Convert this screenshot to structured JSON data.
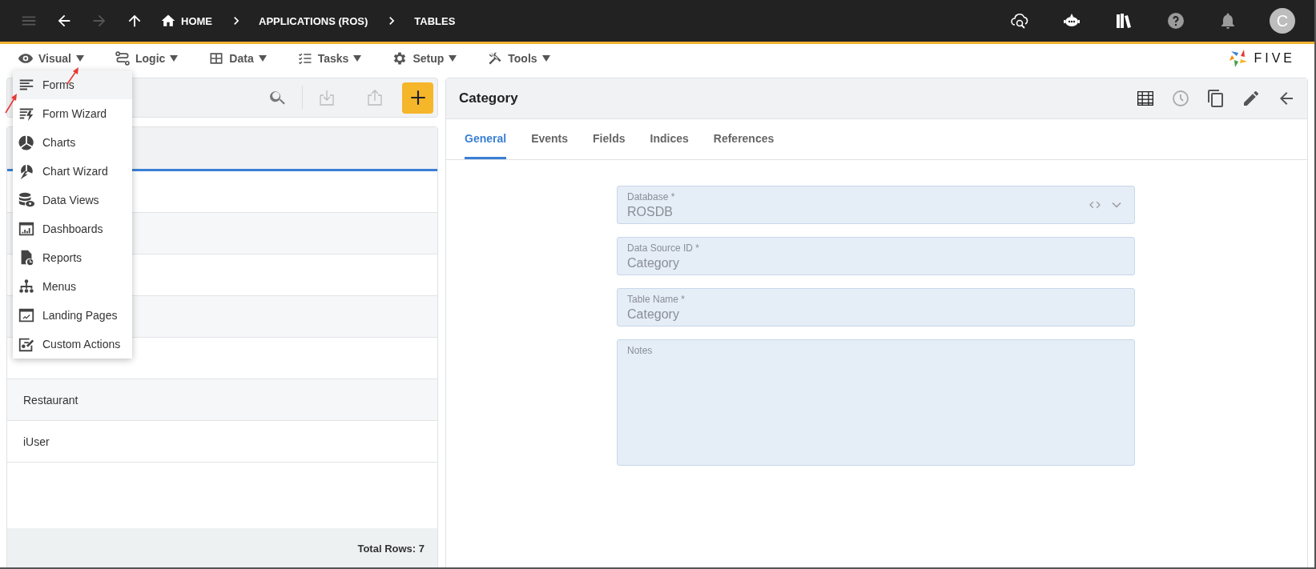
{
  "top_bar": {
    "nav": [
      {
        "kind": "menu",
        "disabled": true
      },
      {
        "kind": "back",
        "disabled": false
      },
      {
        "kind": "forward",
        "disabled": true
      },
      {
        "kind": "up",
        "disabled": false
      }
    ],
    "breadcrumbs": [
      {
        "label": "HOME",
        "kind": "home"
      },
      {
        "label": "APPLICATIONS (ROS)",
        "kind": "plain"
      },
      {
        "label": "TABLES",
        "kind": "plain"
      }
    ],
    "actions": [
      {
        "kind": "cloud-search"
      },
      {
        "kind": "bot"
      },
      {
        "kind": "books"
      },
      {
        "kind": "help"
      },
      {
        "kind": "bell"
      }
    ],
    "avatar": "C"
  },
  "menu_bar": {
    "menus": [
      {
        "label": "Visual",
        "kind": "eye"
      },
      {
        "label": "Logic",
        "kind": "flow"
      },
      {
        "label": "Data",
        "kind": "table"
      },
      {
        "label": "Tasks",
        "kind": "checklist"
      },
      {
        "label": "Setup",
        "kind": "gear"
      },
      {
        "label": "Tools",
        "kind": "tools"
      }
    ],
    "logo": "FIVE"
  },
  "dropdown": {
    "items": [
      {
        "label": "Forms",
        "kind": "forms",
        "selected": true
      },
      {
        "label": "Form Wizard",
        "kind": "form-wizard",
        "selected": false
      },
      {
        "label": "Charts",
        "kind": "charts",
        "selected": false
      },
      {
        "label": "Chart Wizard",
        "kind": "chart-wizard",
        "selected": false
      },
      {
        "label": "Data Views",
        "kind": "data-views",
        "selected": false
      },
      {
        "label": "Dashboards",
        "kind": "dashboards",
        "selected": false
      },
      {
        "label": "Reports",
        "kind": "reports",
        "selected": false
      },
      {
        "label": "Menus",
        "kind": "menus",
        "selected": false
      },
      {
        "label": "Landing Pages",
        "kind": "landing",
        "selected": false
      },
      {
        "label": "Custom Actions",
        "kind": "custom",
        "selected": false
      }
    ]
  },
  "list_toolbar": {
    "tools": [
      {
        "kind": "search",
        "disabled": false
      },
      {
        "kind": "import",
        "disabled": true
      },
      {
        "kind": "export",
        "disabled": true
      }
    ]
  },
  "table": {
    "rows": [
      {},
      {},
      {},
      {},
      {},
      {
        "name": "Restaurant"
      },
      {
        "name": "iUser"
      }
    ],
    "footer": "Total Rows: 7"
  },
  "form": {
    "title": "Category",
    "actions": [
      {
        "kind": "grid",
        "disabled": false
      },
      {
        "kind": "history",
        "disabled": true
      },
      {
        "kind": "copy",
        "disabled": false
      },
      {
        "kind": "edit",
        "disabled": false
      },
      {
        "kind": "back",
        "disabled": false
      }
    ],
    "tabs": [
      {
        "label": "General",
        "selected": true
      },
      {
        "label": "Events",
        "selected": false
      },
      {
        "label": "Fields",
        "selected": false
      },
      {
        "label": "Indices",
        "selected": false
      },
      {
        "label": "References",
        "selected": false
      }
    ],
    "fields": [
      {
        "label": "Database *",
        "value": "ROSDB",
        "kind": "select"
      },
      {
        "label": "Data Source ID *",
        "value": "Category",
        "kind": "text"
      },
      {
        "label": "Table Name *",
        "value": "Category",
        "kind": "text"
      },
      {
        "label": "Notes",
        "kind": "textarea"
      }
    ]
  }
}
